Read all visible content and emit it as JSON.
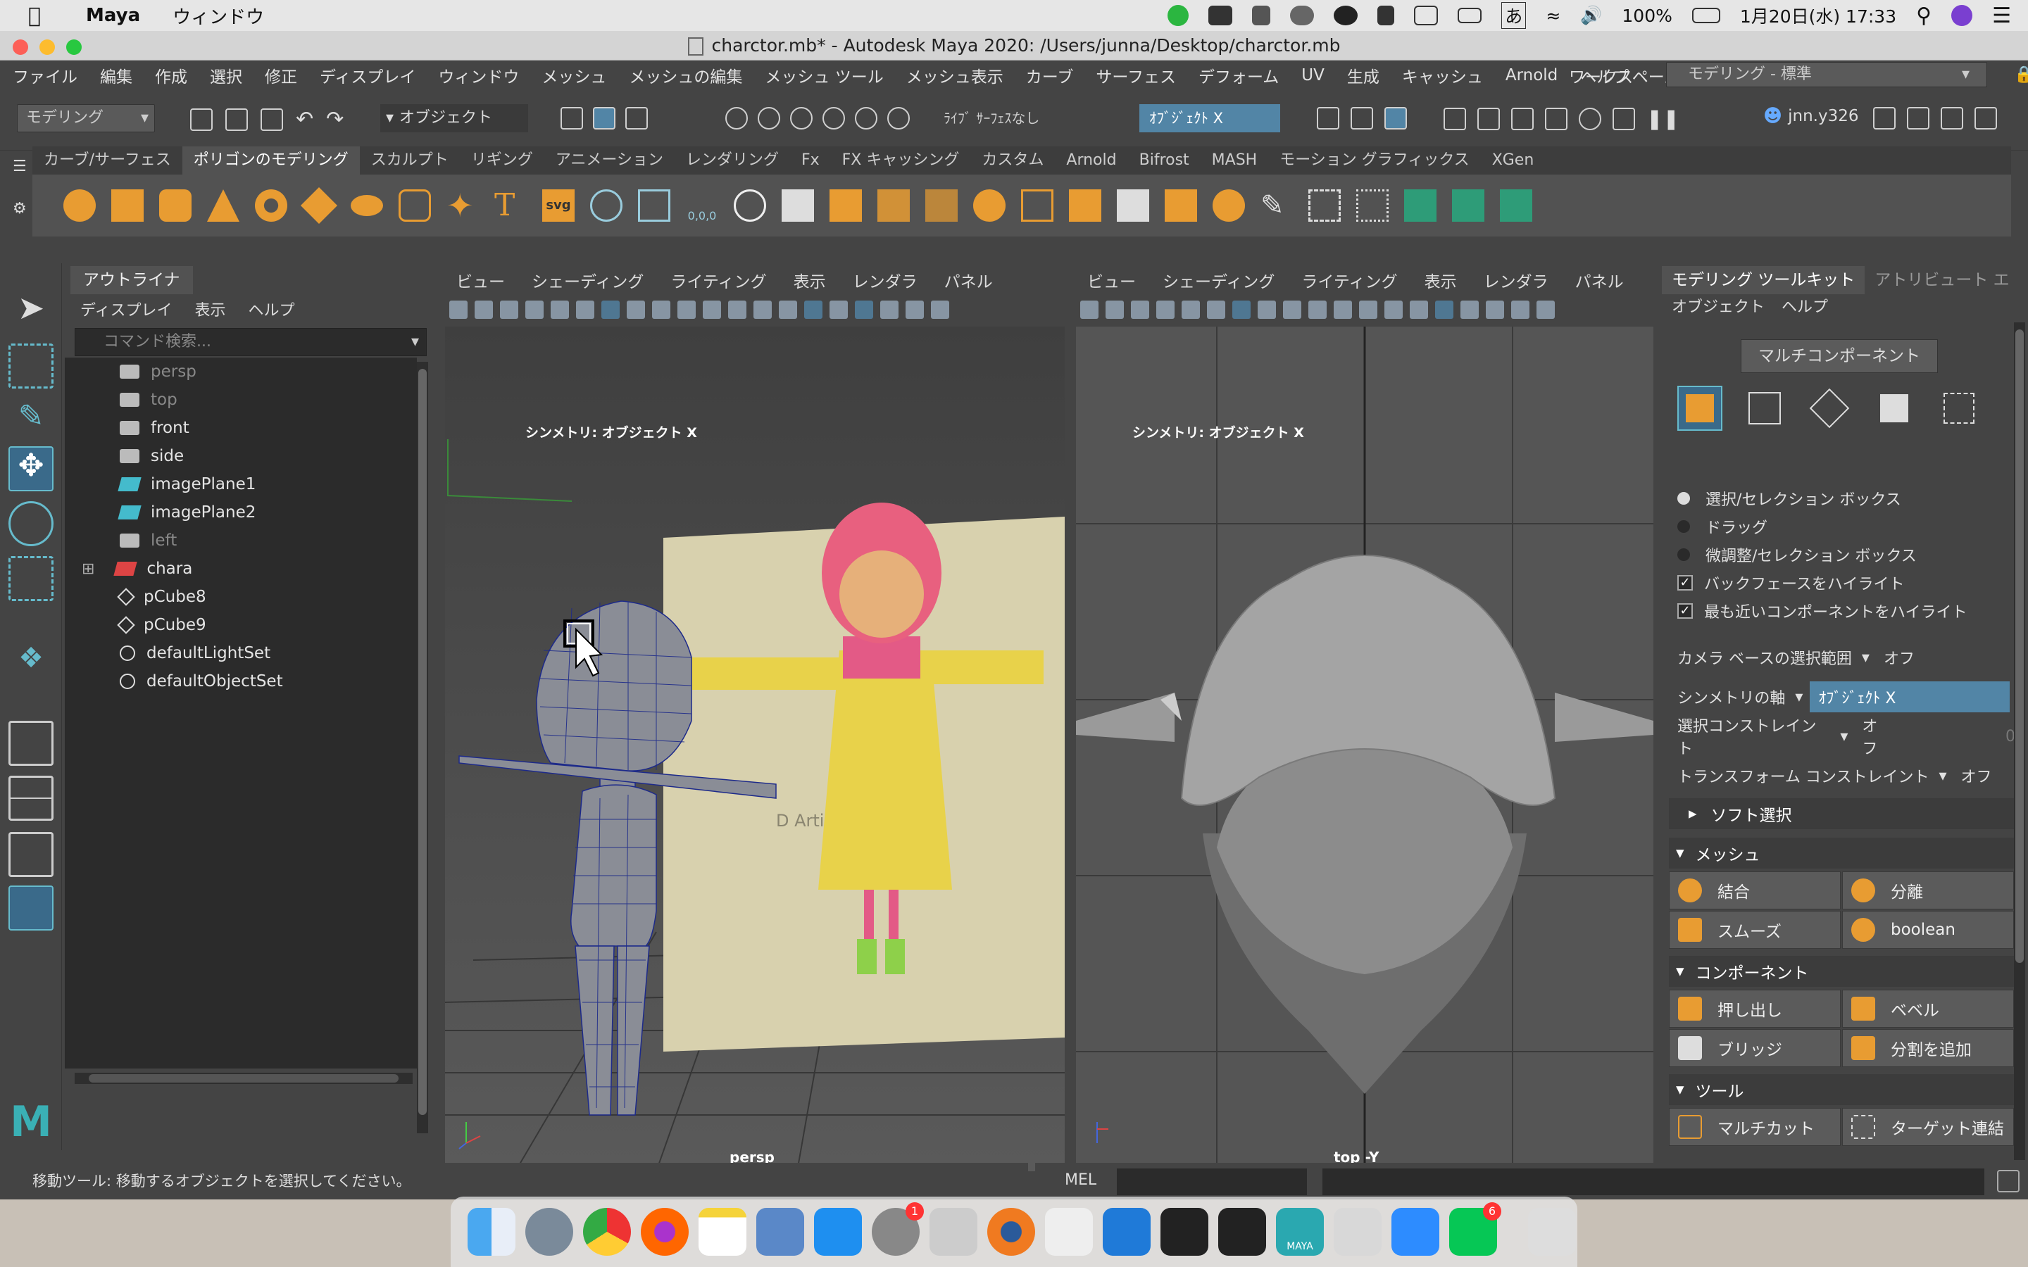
{
  "menubar_mac": {
    "app": "Maya",
    "window_menu": "ウィンドウ",
    "battery": "100%",
    "datetime": "1月20日(水)  17:33",
    "ime": "あ"
  },
  "window": {
    "title": "charctor.mb* - Autodesk Maya 2020: /Users/junna/Desktop/charctor.mb"
  },
  "main_menu": [
    "ファイル",
    "編集",
    "作成",
    "選択",
    "修正",
    "ディスプレイ",
    "ウィンドウ",
    "メッシュ",
    "メッシュの編集",
    "メッシュ ツール",
    "メッシュ表示",
    "カーブ",
    "サーフェス",
    "デフォーム",
    "UV",
    "生成",
    "キャッシュ",
    "Arnold",
    "ヘルプ"
  ],
  "workspace": {
    "label": "ワークスペース:",
    "value": "モデリング - 標準"
  },
  "status_line": {
    "mode": "モデリング",
    "object_mode": "オブジェクト",
    "live_surface": "ﾗｲﾌﾞ ｻｰﾌｪｽなし",
    "symmetry": "ｵﾌﾞｼﾞｪｸﾄ X",
    "user": "jnn.y326"
  },
  "shelf_tabs": [
    "カーブ/サーフェス",
    "ポリゴンのモデリング",
    "スカルプト",
    "リギング",
    "アニメーション",
    "レンダリング",
    "Fx",
    "FX キャッシング",
    "カスタム",
    "Arnold",
    "Bifrost",
    "MASH",
    "モーション グラフィックス",
    "XGen"
  ],
  "shelf_active": "ポリゴンのモデリング",
  "shelf_text_icons": {
    "text": "T",
    "svg": "svg",
    "zero": "0,0,0"
  },
  "outliner": {
    "title": "アウトライナ",
    "menu": [
      "ディスプレイ",
      "表示",
      "ヘルプ"
    ],
    "search_placeholder": "コマンド検索...",
    "items": [
      {
        "label": "persp",
        "icon": "camera-icon",
        "dim": true
      },
      {
        "label": "top",
        "icon": "camera-icon",
        "dim": true
      },
      {
        "label": "front",
        "icon": "camera-icon",
        "dim": false
      },
      {
        "label": "side",
        "icon": "camera-icon",
        "dim": false
      },
      {
        "label": "imagePlane1",
        "icon": "image-plane-icon",
        "dim": false
      },
      {
        "label": "imagePlane2",
        "icon": "image-plane-icon",
        "dim": false
      },
      {
        "label": "left",
        "icon": "camera-icon",
        "dim": true
      },
      {
        "label": "chara",
        "icon": "mesh-icon",
        "dim": false,
        "expandable": true
      },
      {
        "label": "pCube8",
        "icon": "transform-icon",
        "dim": false
      },
      {
        "label": "pCube9",
        "icon": "transform-icon",
        "dim": false
      },
      {
        "label": "defaultLightSet",
        "icon": "set-icon",
        "dim": false
      },
      {
        "label": "defaultObjectSet",
        "icon": "set-icon",
        "dim": false
      }
    ]
  },
  "viewport_menu": [
    "ビュー",
    "シェーディング",
    "ライティング",
    "表示",
    "レンダラ",
    "パネル"
  ],
  "viewport_left": {
    "symmetry": "シンメトリ: オブジェクト X",
    "camera": "persp",
    "watermark": "D Artist"
  },
  "viewport_right": {
    "symmetry": "シンメトリ: オブジェクト X",
    "camera": "top -Y"
  },
  "toolkit": {
    "tabs": [
      "モデリング ツールキット",
      "アトリビュート エ"
    ],
    "menu": [
      "オブジェクト",
      "ヘルプ"
    ],
    "multi_component": "マルチコンポーネント",
    "selection_options": [
      "選択/セレクション ボックス",
      "ドラッグ",
      "微調整/セレクション ボックス"
    ],
    "checks": [
      "バックフェースをハイライト",
      "最も近いコンポーネントをハイライト"
    ],
    "camera_based": {
      "label": "カメラ ベースの選択範囲",
      "value": "オフ"
    },
    "symmetry_axis": {
      "label": "シンメトリの軸",
      "value": "ｵﾌﾞｼﾞｪｸﾄ X"
    },
    "select_constraint": {
      "label": "選択コンストレイント",
      "value": "オフ",
      "num": "0"
    },
    "transform_constraint": {
      "label": "トランスフォーム コンストレイント",
      "value": "オフ"
    },
    "soft_select": "ソフト選択",
    "mesh_section": "メッシュ",
    "mesh_buttons": [
      "結合",
      "分離",
      "スムーズ",
      "boolean"
    ],
    "component_section": "コンポーネント",
    "component_buttons": [
      "押し出し",
      "ベベル",
      "ブリッジ",
      "分割を追加"
    ],
    "tools_section": "ツール",
    "tools_buttons": [
      "マルチカット",
      "ターゲット連結"
    ]
  },
  "help_line": "移動ツール: 移動するオブジェクトを選択してください。",
  "command_line": {
    "lang": "MEL"
  },
  "dock": {
    "badges": {
      "settings": "1",
      "line": "6"
    },
    "maya_label": "MAYA"
  },
  "colors": {
    "accent_blue": "#5285a6",
    "orange": "#e89c32",
    "selected": "#3a6a8a"
  }
}
